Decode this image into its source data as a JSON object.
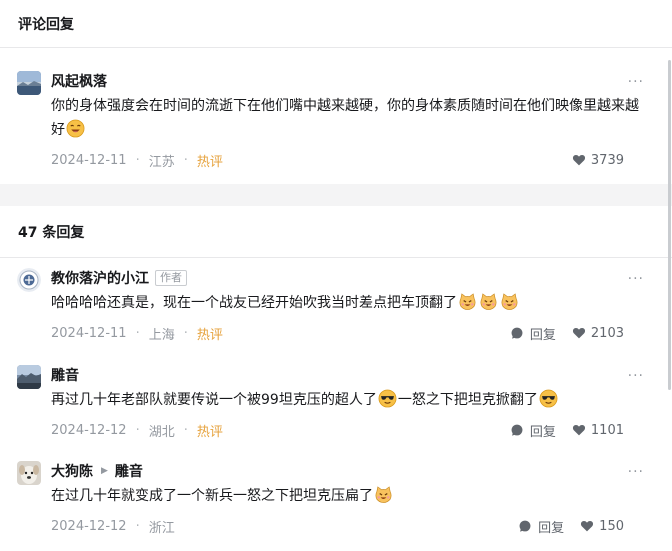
{
  "header": {
    "title": "评论回复"
  },
  "root_comment": {
    "username": "风起枫落",
    "more": "···",
    "content": "你的身体强度会在时间的流逝下在他们嘴中越来越硬，你的身体素质随时间在他们映像里越来越好",
    "date": "2024-12-11",
    "location": "江苏",
    "hot": "热评",
    "likes": "3739"
  },
  "replies_header": {
    "count_label": "47 条回复"
  },
  "replies": [
    {
      "username": "教你落沪的小江",
      "author_tag": "作者",
      "more": "···",
      "content": "哈哈哈哈还真是，现在一个战友已经开始吹我当时差点把车顶翻了",
      "date": "2024-12-11",
      "location": "上海",
      "hot": "热评",
      "reply_label": "回复",
      "likes": "2103"
    },
    {
      "username": "雕音",
      "more": "···",
      "content_a": "再过几十年老部队就要传说一个被99坦克压的超人了",
      "content_b": "一怒之下把坦克掀翻了",
      "date": "2024-12-12",
      "location": "湖北",
      "hot": "热评",
      "reply_label": "回复",
      "likes": "1101"
    },
    {
      "username": "大狗陈",
      "reply_to": "雕音",
      "more": "···",
      "content": "在过几十年就变成了一个新兵一怒之下把坦克压扁了",
      "date": "2024-12-12",
      "location": "浙江",
      "reply_label": "回复",
      "likes": "150"
    }
  ],
  "colors": {
    "hot": "#e6a23c",
    "meta": "#9499a0",
    "text": "#18191c",
    "band": "#f4f4f5"
  }
}
